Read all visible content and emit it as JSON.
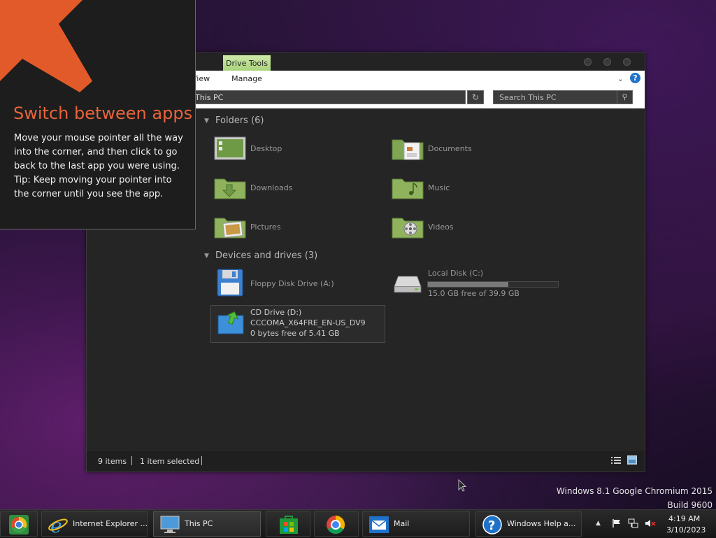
{
  "tip": {
    "title": "Switch between apps",
    "line1": "Move your mouse pointer all the way into the corner, and then click to go back to the last app you were using.",
    "line2": "Tip: Keep moving your pointer into the corner until you see the app."
  },
  "window": {
    "drive_tools_tab": "Drive Tools",
    "ribbon_view_tab": "View",
    "ribbon_manage_tab": "Manage",
    "address": "This PC",
    "search_placeholder": "Search This PC",
    "folders_header": "Folders (6)",
    "folders": [
      {
        "label": "Desktop",
        "icon": "desktop-folder-icon"
      },
      {
        "label": "Documents",
        "icon": "documents-folder-icon"
      },
      {
        "label": "Downloads",
        "icon": "downloads-folder-icon"
      },
      {
        "label": "Music",
        "icon": "music-folder-icon"
      },
      {
        "label": "Pictures",
        "icon": "pictures-folder-icon"
      },
      {
        "label": "Videos",
        "icon": "videos-folder-icon"
      }
    ],
    "devices_header": "Devices and drives (3)",
    "floppy": {
      "label": "Floppy Disk Drive (A:)"
    },
    "local_disk": {
      "label": "Local Disk (C:)",
      "free": "15.0 GB free of 39.9 GB",
      "used_fraction": 0.62
    },
    "cd_drive": {
      "label": "CD Drive (D:)",
      "volume": "CCCOMA_X64FRE_EN-US_DV9",
      "free": "0 bytes free of 5.41 GB"
    },
    "status_items": "9 items",
    "status_selected": "1 item selected"
  },
  "watermark": {
    "line1": "Windows 8.1 Google Chromium 2015",
    "line2": "Build 9600"
  },
  "taskbar": {
    "ie_label": "Internet Explorer ...",
    "thispc_label": "This PC",
    "mail_label": "Mail",
    "help_label": "Windows Help a...",
    "time": "4:19 AM",
    "date": "3/10/2023"
  },
  "colors": {
    "accent_orange": "#e8643a",
    "drive_tools_green": "#b9dd8d",
    "folder_green": "#8fb35c"
  }
}
